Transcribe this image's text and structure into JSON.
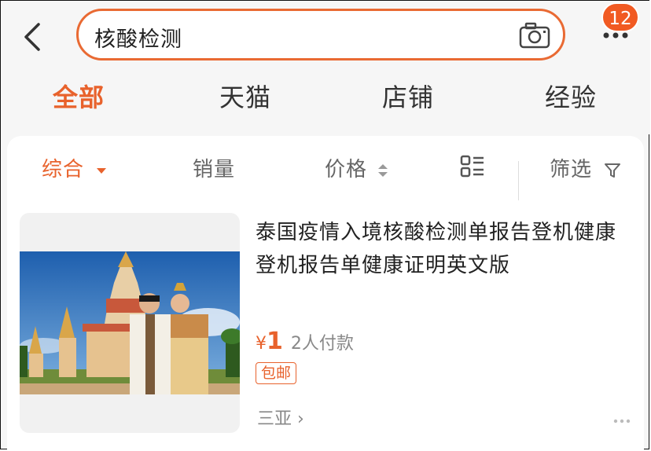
{
  "header": {
    "back_icon": "chevron-left-icon",
    "search_value": "核酸检测",
    "camera_icon": "camera-icon",
    "more_icon": "more-horizontal-icon",
    "badge_count": "12",
    "accent_color": "#e8622c"
  },
  "tabs": [
    {
      "label": "全部",
      "active": true
    },
    {
      "label": "天猫",
      "active": false
    },
    {
      "label": "店铺",
      "active": false
    },
    {
      "label": "经验",
      "active": false
    }
  ],
  "sortbar": {
    "comprehensive": "综合",
    "sales": "销量",
    "price": "价格",
    "layout_icon": "list-view-icon",
    "filter": "筛选",
    "filter_icon": "funnel-icon"
  },
  "product": {
    "title": "泰国疫情入境核酸检测单报告登机健康登机报告单健康证明英文版",
    "currency": "¥",
    "price": "1",
    "sales": "2人付款",
    "tag": "包邮",
    "location": "三亚 ›",
    "image": "temple-couple-photo"
  }
}
